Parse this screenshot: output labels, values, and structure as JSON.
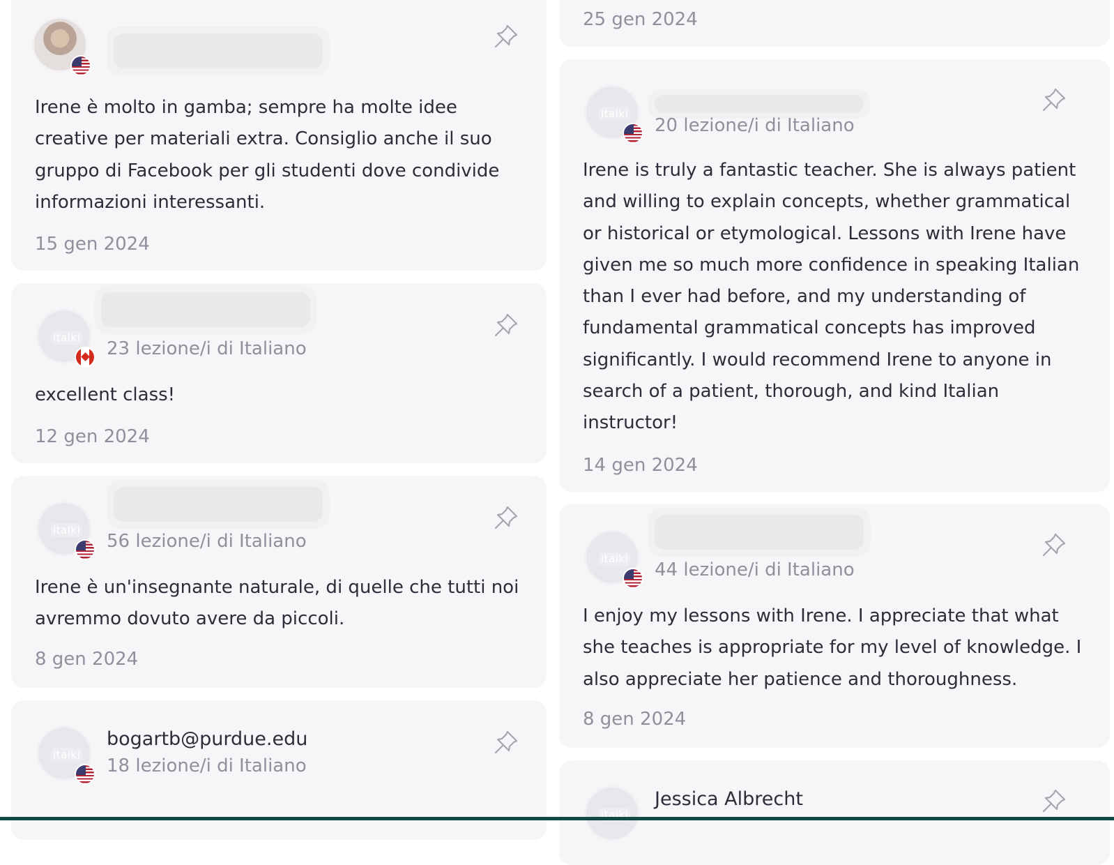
{
  "cards": {
    "c1": {
      "review": "Irene è molto in gamba; sempre ha molte idee creative per materiali extra. Consiglio anche il suo gruppo di Facebook per gli studenti dove condivide informazioni interessanti.",
      "date": "15 gen 2024",
      "flag": "us"
    },
    "c2": {
      "lessons": "23 lezione/i di Italiano",
      "review": "excellent class!",
      "date": "12 gen 2024",
      "flag": "ca"
    },
    "c3": {
      "lessons": "56 lezione/i di Italiano",
      "review": "Irene è un'insegnante naturale, di quelle che tutti noi avremmo dovuto avere da piccoli.",
      "date": "8 gen 2024",
      "flag": "us"
    },
    "c4": {
      "name": "bogartb@purdue.edu",
      "lessons": "18 lezione/i di Italiano",
      "flag": "us"
    },
    "c5": {
      "date": "25 gen 2024"
    },
    "c6": {
      "lessons": "20 lezione/i di Italiano",
      "review": "Irene is truly a fantastic teacher. She is always patient and willing to explain concepts, whether grammatical or historical or etymological. Lessons with Irene have given me so much more confidence in speaking Italian than I ever had before, and my understanding of fundamental grammatical concepts has improved significantly. I would recommend Irene to anyone in search of a patient, thorough, and kind Italian instructor!",
      "date": "14 gen 2024",
      "flag": "us"
    },
    "c7": {
      "lessons": "44 lezione/i di Italiano",
      "review": "I enjoy my lessons with Irene. I appreciate that what she teaches is appropriate for my level of knowledge. I also appreciate her patience and thoroughness.",
      "date": "8 gen 2024",
      "flag": "us"
    },
    "c8": {
      "name": "Jessica Albrecht"
    }
  },
  "avatar_logo_text": "italki",
  "icons": {
    "pin": "pin-icon"
  },
  "colors": {
    "card_bg": "#f6f6f8",
    "muted_text": "#8e909c",
    "body_text": "#2b2d38",
    "bottom_bar": "#0f4a45"
  }
}
